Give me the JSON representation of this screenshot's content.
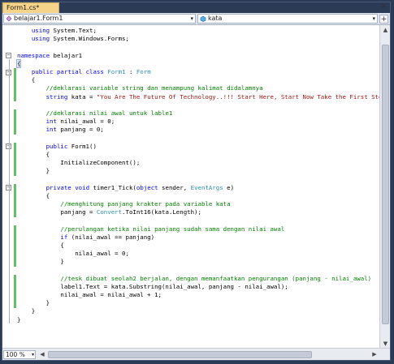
{
  "tab": {
    "title": "Form1.cs*",
    "close": "×"
  },
  "nav": {
    "type_dropdown": "belajar1.Form1",
    "member_dropdown": "kata",
    "arrow": "▾",
    "split": "+"
  },
  "editor": {
    "lines": [
      [
        {
          "t": "    "
        },
        {
          "t": "using",
          "c": "kw"
        },
        {
          "t": " System.Text;"
        }
      ],
      [
        {
          "t": "    "
        },
        {
          "t": "using",
          "c": "kw"
        },
        {
          "t": " System.Windows.Forms;"
        }
      ],
      [
        {
          "t": ""
        }
      ],
      [
        {
          "t": "namespace",
          "c": "kw"
        },
        {
          "t": " belajar1"
        }
      ],
      [
        {
          "t": "{"
        }
      ],
      [
        {
          "t": "    "
        },
        {
          "t": "public",
          "c": "kw"
        },
        {
          "t": " "
        },
        {
          "t": "partial",
          "c": "kw"
        },
        {
          "t": " "
        },
        {
          "t": "class",
          "c": "kw"
        },
        {
          "t": " "
        },
        {
          "t": "Form1",
          "c": "ty"
        },
        {
          "t": " : "
        },
        {
          "t": "Form",
          "c": "ty"
        }
      ],
      [
        {
          "t": "    {"
        }
      ],
      [
        {
          "t": "        "
        },
        {
          "t": "//deklarasi variable string dan menampung kalimat didalamnya",
          "c": "cm"
        }
      ],
      [
        {
          "t": "        "
        },
        {
          "t": "string",
          "c": "kw"
        },
        {
          "t": " kata = "
        },
        {
          "t": "\"You Are The Future Of Technology..!!! Start Here, Start Now Take the First Step. Te",
          "c": "str"
        }
      ],
      [
        {
          "t": ""
        }
      ],
      [
        {
          "t": "        "
        },
        {
          "t": "//deklarasi nilai awal untuk lable1",
          "c": "cm"
        }
      ],
      [
        {
          "t": "        "
        },
        {
          "t": "int",
          "c": "kw"
        },
        {
          "t": " nilai_awal = 0;"
        }
      ],
      [
        {
          "t": "        "
        },
        {
          "t": "int",
          "c": "kw"
        },
        {
          "t": " panjang = 0;"
        }
      ],
      [
        {
          "t": ""
        }
      ],
      [
        {
          "t": "        "
        },
        {
          "t": "public",
          "c": "kw"
        },
        {
          "t": " Form1()"
        }
      ],
      [
        {
          "t": "        {"
        }
      ],
      [
        {
          "t": "            InitializeComponent();"
        }
      ],
      [
        {
          "t": "        }"
        }
      ],
      [
        {
          "t": ""
        }
      ],
      [
        {
          "t": "        "
        },
        {
          "t": "private",
          "c": "kw"
        },
        {
          "t": " "
        },
        {
          "t": "void",
          "c": "kw"
        },
        {
          "t": " timer1_Tick("
        },
        {
          "t": "object",
          "c": "kw"
        },
        {
          "t": " sender, "
        },
        {
          "t": "EventArgs",
          "c": "ty"
        },
        {
          "t": " e)"
        }
      ],
      [
        {
          "t": "        {"
        }
      ],
      [
        {
          "t": "            "
        },
        {
          "t": "//menghitung panjang krakter pada variable kata",
          "c": "cm"
        }
      ],
      [
        {
          "t": "            panjang = "
        },
        {
          "t": "Convert",
          "c": "ty"
        },
        {
          "t": ".ToInt16(kata.Length);"
        }
      ],
      [
        {
          "t": ""
        }
      ],
      [
        {
          "t": "            "
        },
        {
          "t": "//perulangan ketika nilai panjang sudah sama dengan nilai awal",
          "c": "cm"
        }
      ],
      [
        {
          "t": "            "
        },
        {
          "t": "if",
          "c": "kw"
        },
        {
          "t": " (nilai_awal == panjang)"
        }
      ],
      [
        {
          "t": "            {"
        }
      ],
      [
        {
          "t": "                nilai_awal = 0;"
        }
      ],
      [
        {
          "t": "            }"
        }
      ],
      [
        {
          "t": ""
        }
      ],
      [
        {
          "t": "            "
        },
        {
          "t": "//tesk dibuat seolah2 berjalan, dengan memanfaatkan pengurangan (panjang - nilai_awal)",
          "c": "cm"
        }
      ],
      [
        {
          "t": "            label1.Text = kata.Substring(nilai_awal, panjang - nilai_awal);"
        }
      ],
      [
        {
          "t": "            nilai_awal = nilai_awal + 1;"
        }
      ],
      [
        {
          "t": "        }"
        }
      ],
      [
        {
          "t": "    }"
        }
      ],
      [
        {
          "t": "}"
        }
      ]
    ],
    "changed_lines": [
      5,
      6,
      7,
      8,
      10,
      11,
      12,
      14,
      15,
      16,
      17,
      19,
      20,
      21,
      22,
      24,
      25,
      26,
      27,
      28,
      30,
      31,
      32,
      33
    ],
    "outline_lines": [
      3,
      5,
      14,
      19
    ]
  },
  "status": {
    "zoom": "100 %",
    "zoom_arrow": "▾"
  },
  "scroll": {
    "up": "▲",
    "down": "▼",
    "left": "◀",
    "right": "▶"
  },
  "colors": {
    "changebar": "#5fc15f",
    "keyword": "#0000ff",
    "type": "#2b91af",
    "string": "#a31515",
    "comment": "#008000",
    "tab": "#f5d48a"
  }
}
